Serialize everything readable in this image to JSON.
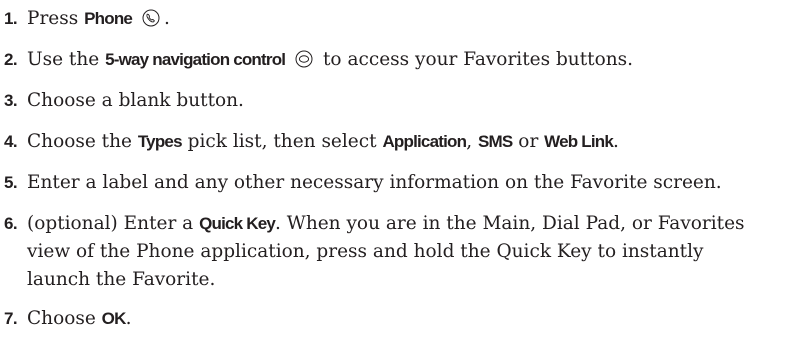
{
  "steps": [
    {
      "number": "1.",
      "t1": "Press ",
      "b1": "Phone",
      "icon": "phone-icon",
      "t2": "."
    },
    {
      "number": "2.",
      "t1": "Use the ",
      "b1": "5-way navigation control",
      "icon": "five-way-navigation-icon",
      "t2": " to access your Favorites buttons."
    },
    {
      "number": "3.",
      "t1": "Choose a blank button."
    },
    {
      "number": "4.",
      "t1": "Choose the ",
      "b1": "Types",
      "t2": " pick list, then select ",
      "b2": "Application",
      "t3": ", ",
      "b3": "SMS",
      "t4": " or ",
      "b4": "Web Link",
      "t5": "."
    },
    {
      "number": "5.",
      "t1": "Enter a label and any other necessary information on the Favorite screen."
    },
    {
      "number": "6.",
      "t1": "(optional) Enter a ",
      "b1": "Quick Key",
      "t2": ". When you are in the Main, Dial Pad, or Favorites",
      "l2": "view of the Phone application, press and hold the Quick Key to instantly",
      "l3": "launch the Favorite."
    },
    {
      "number": "7.",
      "t1": "Choose ",
      "b1": "OK",
      "t2": "."
    }
  ]
}
